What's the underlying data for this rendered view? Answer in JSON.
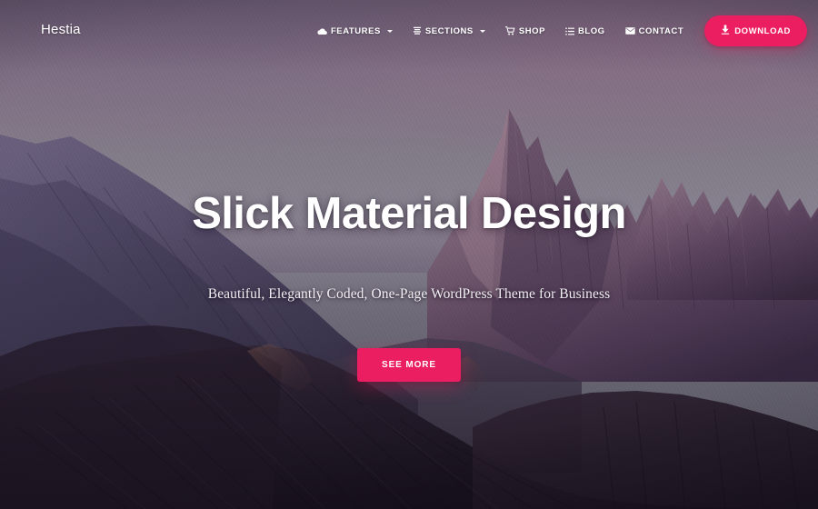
{
  "site": {
    "brand": "Hestia"
  },
  "colors": {
    "accent": "#ec1e62",
    "text_light": "#ffffff",
    "sky_top": "#7d7285",
    "sky_mid": "#8b8690",
    "rock_dark": "#241c2a"
  },
  "nav": {
    "items": [
      {
        "label": "Features",
        "icon": "cloud-icon",
        "has_dropdown": true
      },
      {
        "label": "Sections",
        "icon": "layers-icon",
        "has_dropdown": true
      },
      {
        "label": "Shop",
        "icon": "cart-icon",
        "has_dropdown": false
      },
      {
        "label": "Blog",
        "icon": "list-icon",
        "has_dropdown": false
      },
      {
        "label": "Contact",
        "icon": "envelope-icon",
        "has_dropdown": false
      }
    ],
    "cta": {
      "label": "Download",
      "icon": "download-icon"
    }
  },
  "hero": {
    "title": "Slick Material Design",
    "subtitle": "Beautiful, Elegantly Coded, One-Page WordPress Theme for Business",
    "button_label": "See More"
  }
}
